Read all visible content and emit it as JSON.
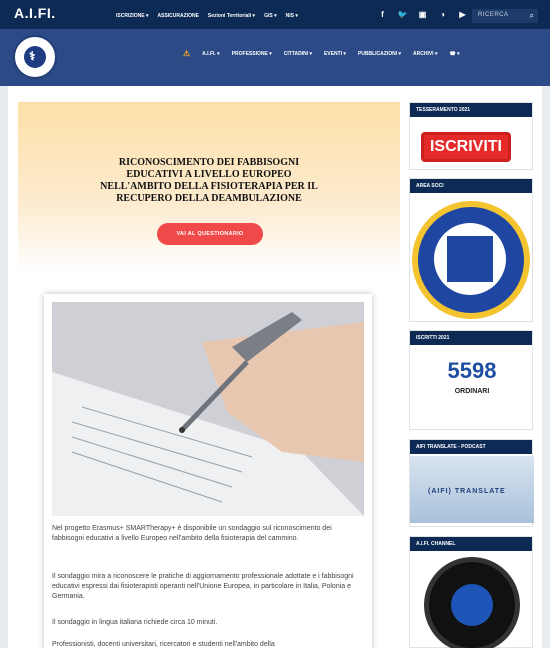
{
  "topbar": {
    "brand": "A.I.FI.",
    "nav": [
      "ISCRIZIONE ▾",
      "ASSICURAZIONE",
      "Sezioni Territoriali ▾",
      "GIS ▾",
      "NIS ▾"
    ],
    "social": [
      "f",
      "🐦",
      "▣",
      "◑",
      "▶"
    ],
    "search_placeholder": "RICERCA",
    "search_icon": "⌕"
  },
  "mainnav": {
    "warn_icon": "⚠",
    "items": [
      "A.I.FI. ▾",
      "PROFESSIONE ▾",
      "CITTADINI ▾",
      "EVENTI ▾",
      "PUBBLICAZIONI ▾",
      "ARCHIVI ▾"
    ],
    "phone_icon": "☎ ▾"
  },
  "hero": {
    "title": "RICONOSCIMENTO DEI FABBISOGNI EDUCATIVI A LIVELLO EUROPEO NELL'AMBITO DELLA FISIOTERAPIA PER IL RECUPERO DELLA DEAMBULAZIONE",
    "cta": "VAI AL QUESTIONARIO"
  },
  "article": {
    "p1": "Nel progetto Erasmus+ SMARTherapy+ è disponibile un sondaggio sul riconoscimento dei fabbisogni educativi a livello Europeo nell'ambito della fisioterapia del cammino.",
    "p2": "Il sondaggio mira a riconoscere le pratiche di aggiornamento professionale adottate e i fabbisogni educativi espressi dai fisioterapisti operanti nell'Unione Europea, in particolare in Italia, Polonia e Germania.",
    "p3": "Il sondaggio in lingua italiana richiede circa 10 minuti.",
    "p4": "Professionisti, docenti universitari, ricercatori e studenti nell'ambito della"
  },
  "sidebar": {
    "w1_title": "TESSERAMENTO 2021",
    "w1_button": "ISCRIVITI",
    "w2_title": "AREA SOCI",
    "w3_title": "ISCRITTI 2021",
    "w3_count": "5598",
    "w3_label": "ORDINARI",
    "w4_title": "AIFI TRANSLATE - PODCAST",
    "w4_image_text": "(AIFI) TRANSLATE",
    "w5_title": "A.I.FI. CHANNEL"
  }
}
